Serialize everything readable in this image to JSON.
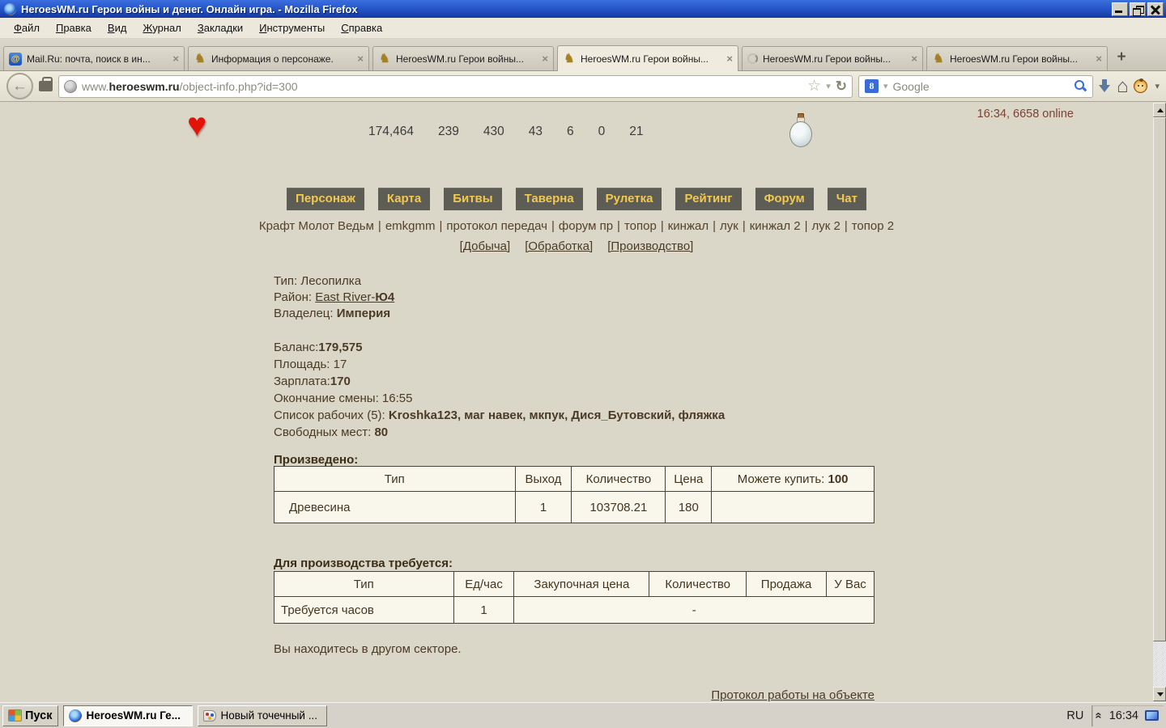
{
  "colors": {
    "titlebar_blue": "#2353c6",
    "page_bg": "#dbd7c8",
    "button_bg": "#5d5d55",
    "button_gold": "#f2c94e",
    "text_brown": "#4a3a26",
    "table_bg": "#f9f6ec",
    "heart_red": "#e01408"
  },
  "window": {
    "title": "HeroesWM.ru Герои войны и денег. Онлайн игра. - Mozilla Firefox"
  },
  "menubar": {
    "items": [
      "Файл",
      "Правка",
      "Вид",
      "Журнал",
      "Закладки",
      "Инструменты",
      "Справка"
    ]
  },
  "icons": {
    "close_tab": "×",
    "new_tab": "+",
    "back": "←",
    "star": "☆",
    "dropdown": "▾",
    "refresh": "↻",
    "home": "⌂",
    "knight": "♞",
    "at": "@",
    "google": "8",
    "chevron": "«",
    "heart": "♥"
  },
  "tabstrip": {
    "tabs": [
      {
        "title": "Mail.Ru: почта, поиск в ин...",
        "icon": "mailru-icon",
        "active": false
      },
      {
        "title": "Информация о персонаже.",
        "icon": "knight-icon",
        "active": false
      },
      {
        "title": "HeroesWM.ru Герои войны...",
        "icon": "knight-icon",
        "active": false
      },
      {
        "title": "HeroesWM.ru Герои войны...",
        "icon": "knight-icon",
        "active": true
      },
      {
        "title": "HeroesWM.ru Герои войны...",
        "icon": "spinner-icon",
        "active": false
      },
      {
        "title": "HeroesWM.ru Герои войны...",
        "icon": "knight-icon",
        "active": false
      }
    ]
  },
  "navbar": {
    "url_prefix": "www.",
    "url_host": "heroeswm.ru",
    "url_path": "/object-info.php?id=300",
    "search_placeholder": "Google"
  },
  "page": {
    "status_right": "16:34, 6658 online",
    "counters": [
      "174,464",
      "239",
      "430",
      "43",
      "6",
      "0",
      "21"
    ],
    "nav_buttons": [
      "Персонаж",
      "Карта",
      "Битвы",
      "Таверна",
      "Рулетка",
      "Рейтинг",
      "Форум",
      "Чат"
    ],
    "sep": "|",
    "quick_links": [
      "Крафт Молот Ведьм",
      "emkgmm",
      "протокол передач",
      "форум пр",
      "топор",
      "кинжал",
      "лук",
      "кинжал 2",
      "лук 2",
      "топор 2"
    ],
    "section_links": [
      "[Добыча]",
      "[Обработка]",
      "[Производство]"
    ],
    "info": {
      "type_label": "Тип:",
      "type_value": "Лесопилка",
      "district_label": "Район:",
      "district_value": "East River-",
      "district_value_bold": "Ю4",
      "owner_label": "Владелец:",
      "owner_value": "Империя"
    },
    "stats": {
      "balance_label": "Баланс:",
      "balance_value": "179,575",
      "area_label": "Площадь:",
      "area_value": "17",
      "salary_label": "Зарплата:",
      "salary_value": "170",
      "shift_label": "Окончание смены:",
      "shift_value": "16:55",
      "workers_label": "Список рабочих (5):",
      "workers": [
        "Kroshka123",
        "маг навек",
        "мкпук",
        "Дися_Бутовский",
        "фляжка"
      ],
      "free_label": "Свободных мест:",
      "free_value": "80"
    },
    "produced": {
      "title": "Произведено:",
      "headers": [
        "Тип",
        "Выход",
        "Количество",
        "Цена",
        "Можете купить:"
      ],
      "can_buy": "100",
      "rows": [
        {
          "type": "Древесина",
          "out": "1",
          "qty": "103708.21",
          "price": "180"
        }
      ]
    },
    "requires": {
      "title": "Для производства требуется:",
      "headers": [
        "Тип",
        "Ед/час",
        "Закупочная цена",
        "Количество",
        "Продажа",
        "У Вас"
      ],
      "rows": [
        {
          "type": "Требуется часов",
          "per_hour": "1",
          "rest": "-"
        }
      ]
    },
    "note": "Вы находитесь в другом секторе.",
    "protocol_link": "Протокол работы на объекте"
  },
  "taskbar": {
    "start": "Пуск",
    "tasks": [
      {
        "label": "HeroesWM.ru Ге...",
        "active": true
      },
      {
        "label": "Новый точечный ...",
        "active": false
      }
    ],
    "lang": "RU",
    "clock": "16:34"
  }
}
